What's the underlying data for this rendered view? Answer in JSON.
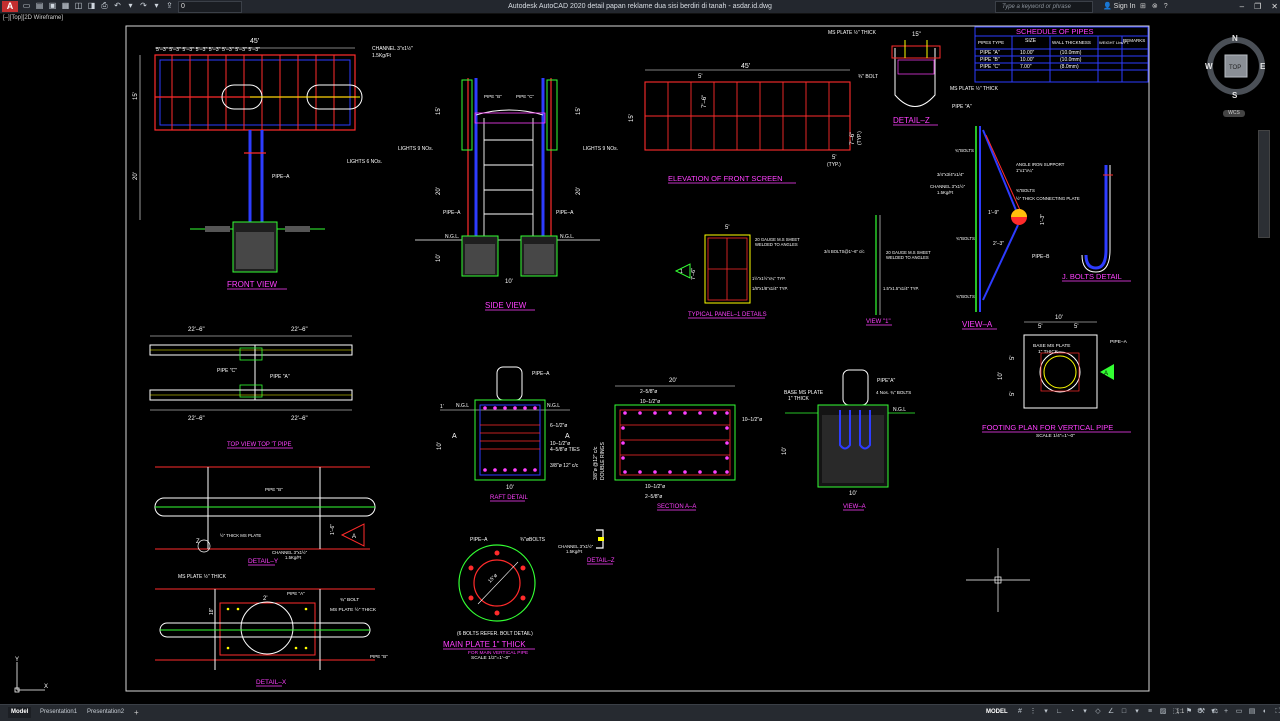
{
  "window": {
    "app_logo": "A",
    "layer_name": "0",
    "title": "Autodesk AutoCAD 2020   detail papan reklame dua sisi berdiri di tanah - asdar.id.dwg",
    "search_placeholder": "Type a keyword or phrase",
    "sign_in": "Sign In"
  },
  "viewport": {
    "label": "[–][Top][2D Wireframe]"
  },
  "viewcube": {
    "north": "N",
    "south": "S",
    "east": "E",
    "west": "W",
    "face": "TOP",
    "wcs": "WCS"
  },
  "ucs": {
    "x": "X",
    "y": "Y"
  },
  "status": {
    "tabs": [
      "Model",
      "Presentation1",
      "Presentation2"
    ],
    "add_tab": "+",
    "model": "MODEL",
    "scale": "1:1"
  },
  "colors": {
    "red": "#ff2b2b",
    "white": "#ffffff",
    "magenta": "#ff40ff",
    "yellow": "#ffff00",
    "green": "#33ff33",
    "blue": "#2d3cff",
    "cyan": "#33ffff",
    "frame": "#d9d9d9"
  },
  "drawing": {
    "front_view": {
      "title": "FRONT VIEW",
      "dim_top": "45'",
      "spacing": "5'–3\"  5'–3\"  5'–3\"  5'–3\"  5'–3\"  5'–3\"  5'–3\"  5'–3\"",
      "dim_height": "15'",
      "dim_post": "20'",
      "channel": "CHANNEL 3\"x1½\"",
      "channel_weight": "1.5Kg/Ft",
      "lights": "LIGHTS 6 NOs.",
      "pipe": "PIPE–A"
    },
    "side_view": {
      "title": "SIDE VIEW",
      "dim_top": "15'",
      "dim_mid": "20'",
      "dim_bottom": "10'",
      "lights_left": "LIGHTS 9 NOs.",
      "lights_right": "LIGHTS 9 NOs.",
      "pipe_left": "PIPE–A",
      "pipe_right": "PIPE–A",
      "ngl_left": "N.G.L.",
      "ngl_right": "N.G.L.",
      "pipe_b": "PIPE \"B\"",
      "pipe_c": "PIPE \"C\"",
      "dim_base": "10'"
    },
    "elevation": {
      "title": "ELEVATION OF FRONT SCREEN",
      "dim_top": "45'",
      "dim_panel": "5'",
      "dim_height": "15'",
      "dim_bay": "7'–6\"",
      "dim_right": "7'–6\"",
      "dim_right2": "(TYP.)",
      "dim_bottom": "5'",
      "dim_bottom2": "(TYP.)"
    },
    "detail_z": {
      "title": "DETAIL–Z",
      "plate_top": "MS PLATE ½\" THICK",
      "dim_top": "15\"",
      "bolt": "¾\" BOLT",
      "plate_bottom": "MS PLATE ½\" THICK",
      "pipe": "PIPE \"A\""
    },
    "schedule": {
      "title": "SCHEDULE OF PIPES",
      "headers": [
        "PIPES TYPE",
        "SIZE",
        "WALL THICKNESS",
        "WEIGHT Lbs/FT.",
        "REMARKS"
      ],
      "rows": [
        [
          "PIPE \"A\"",
          "10.00\"",
          "(10.0mm)",
          "",
          ""
        ],
        [
          "PIPE \"B\"",
          "10.00\"",
          "(10.0mm)",
          "",
          ""
        ],
        [
          "PIPE \"C\"",
          "7.00\"",
          "(8.0mm)",
          "",
          ""
        ]
      ]
    },
    "view_a": {
      "title": "VIEW–A",
      "notes": [
        "¾\"BOLTS",
        "ANGLE IRON SUPPORT",
        "1\"x1\"x¼\"",
        "3/4\"x3/4\"x1/4\"",
        "CHANNEL 3\"x1½\"",
        "1.5Kg/Ft",
        "¾\"BOLTS",
        "½\" THICK CONNECTING PLATE",
        "1'–9\"",
        "¾\"BOLTS",
        "2'–3\"",
        "PIPE–B",
        "¾\"BOLTS"
      ],
      "dim": "1'–3\""
    },
    "j_bolts": {
      "title": "J. BOLTS DETAIL"
    },
    "typical_panel": {
      "title": "TYPICAL PANEL–1 DETAILS",
      "dim_top": "5'",
      "dim_side": "7'–6\"",
      "note1": "20 GAUGE M.S SHEET",
      "note1b": "WELDED TO ANGLES",
      "note2": "1½\"x1½\"x¼\" TYP.",
      "note3": "1/8\"x1/8\"x1/4\" TYP.",
      "marker": "1"
    },
    "view_1": {
      "title": "VIEW \"1\"",
      "note1": "3/4 BOLTS@1'–6\" c/c",
      "note2": "20 GAUGE M.S SHEET",
      "note2b": "WELDED TO ANGLES",
      "note3": "1.5\"x1.5\"x1/4\" TYP."
    },
    "top_view": {
      "title": "TOP VIEW TOP 'T PIPE",
      "dim_tl": "22'–6\"",
      "dim_tr": "22'–6\"",
      "dim_bl": "22'–6\"",
      "dim_br": "22'–6\"",
      "pipe_c": "PIPE \"C\"",
      "pipe_a": "PIPE \"A\""
    },
    "detail_y": {
      "title": "DETAIL–Y",
      "pipe_b": "PIPE \"B\"",
      "plate": "½\" THICK MS PLATE",
      "channel": "CHANNEL 3\"x1½\"",
      "channel_weight": "1.5Kg/Ft",
      "dim": "1'–6\"",
      "marker_z": "Z",
      "marker_a": "A"
    },
    "detail_x": {
      "title": "DETAIL–X",
      "plate_top": "MS PLATE ½\" THICK",
      "pipe": "PIPE \"A\"",
      "bolt": "¾\" BOLT",
      "plate_right": "MS PLATE ½\" THICK",
      "dim": "2'",
      "dim_side": "18\"",
      "pipe_b": "PIPE \"B\""
    },
    "raft": {
      "title": "RAFT DETAIL",
      "pipe": "PIPE–A",
      "ngl_l": "N.G.L",
      "ngl_r": "N.G.L",
      "dim_side": "10'",
      "dim_bottom": "10'",
      "reinf1": "6–1/2\"ø",
      "reinf2": "10–1/2\"ø",
      "reinf3": "4–5/8\"ø TIES",
      "reinf4": "3/8\"ø 12\" c/c",
      "dim_top": "1'",
      "marker_l": "A",
      "marker_r": "A"
    },
    "section_aa": {
      "title": "SECTION A–A",
      "dim_top": "20'",
      "dim_top2": "2–5/8\"ø",
      "dim_top3": "10–1/2\"ø",
      "dim_bottom": "10–1/2\"ø",
      "dim_bottom2": "2–5/8\"ø",
      "dim_right": "10–1/2\"ø",
      "side": "DOUBLE RINGS",
      "side2": "3/8\"ø @12\" c/c"
    },
    "view_a2": {
      "title": "VIEW–A",
      "pipe": "PIPE\"A\"",
      "plate": "BASE MS PLATE",
      "plate2": "1\" THICK",
      "bolts": "4 Nos. ¾\" BOLTS",
      "ngl": "N.G.L",
      "dim_side": "10'",
      "dim_bottom": "10'"
    },
    "footing": {
      "title": "FOOTING PLAN FOR VERTICAL PIPE",
      "scale": "SCALE 1/4\"=1'–0\"",
      "dim_top": "10'",
      "dim_tl": "5'",
      "dim_tr": "5'",
      "dim_side": "10'",
      "dim_sl": "5'",
      "dim_sb": "5'",
      "plate": "BASE MS PLATE",
      "plate2": "1\" THICK",
      "pipe": "PIPE–A",
      "marker": "A"
    },
    "main_plate": {
      "title": "MAIN PLATE 1\" THICK",
      "sub": "FOR MAIN VERTICAL PIPE",
      "scale": "SCALE 1/2\"=1'–0\"",
      "note": "(6 BOLTS REFER. BOLT DETAIL)",
      "pipe": "PIPE–A",
      "bolts": "¾\"øBOLTS",
      "dim": "15\"ø"
    },
    "detail_z2": {
      "title": "DETAIL–Z",
      "note": "CHANNEL 3\"x1½\"",
      "note2": "1.5Kg/Ft"
    }
  }
}
